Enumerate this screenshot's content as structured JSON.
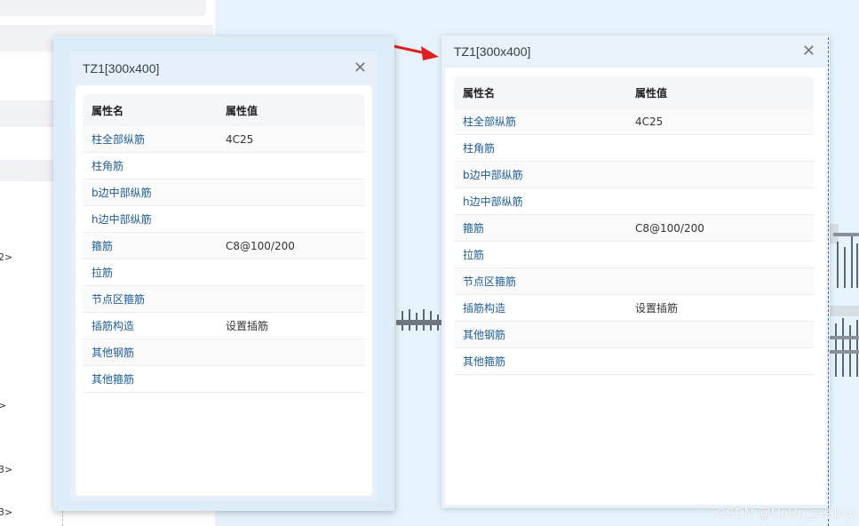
{
  "background": {
    "tree_marks": [
      "2>",
      ">",
      "3>",
      "3>"
    ]
  },
  "window_original": {
    "title": "TZ1[300x400]",
    "close_icon": "close-icon",
    "columns": [
      "属性名",
      "属性值"
    ],
    "rows": [
      {
        "name": "柱全部纵筋",
        "value": "4C25"
      },
      {
        "name": "柱角筋",
        "value": ""
      },
      {
        "name": "b边中部纵筋",
        "value": ""
      },
      {
        "name": "h边中部纵筋",
        "value": ""
      },
      {
        "name": "箍筋",
        "value": "C8@100/200"
      },
      {
        "name": "拉筋",
        "value": ""
      },
      {
        "name": "节点区箍筋",
        "value": ""
      },
      {
        "name": "插筋构造",
        "value": "设置插筋"
      },
      {
        "name": "其他钢筋",
        "value": ""
      },
      {
        "name": "其他箍筋",
        "value": ""
      }
    ]
  },
  "window_modified": {
    "title": "TZ1[300x400]",
    "close_icon": "close-icon",
    "columns": [
      "属性名",
      "属性值"
    ],
    "rows": [
      {
        "name": "柱全部纵筋",
        "value": "4C25"
      },
      {
        "name": "柱角筋",
        "value": ""
      },
      {
        "name": "b边中部纵筋",
        "value": ""
      },
      {
        "name": "h边中部纵筋",
        "value": ""
      },
      {
        "name": "箍筋",
        "value": "C8@100/200"
      },
      {
        "name": "拉筋",
        "value": ""
      },
      {
        "name": "节点区箍筋",
        "value": ""
      },
      {
        "name": "插筋构造",
        "value": "设置插筋"
      },
      {
        "name": "其他钢筋",
        "value": ""
      },
      {
        "name": "其他箍筋",
        "value": ""
      }
    ]
  },
  "annotation": {
    "arrow_color": "#e02020",
    "arrow_icon": "red-arrow-icon"
  },
  "watermark": "CSDN @UpUp_seaboy",
  "colors": {
    "canvas_bg": "#e6f3fc",
    "name_text": "#1d5c98",
    "header_bg": "#f5f6fa"
  }
}
